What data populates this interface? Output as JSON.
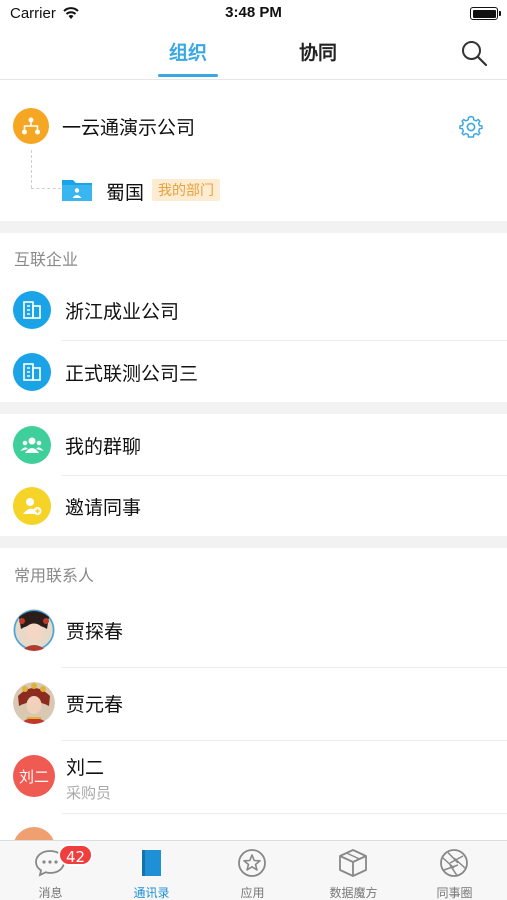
{
  "status_bar": {
    "carrier": "Carrier",
    "time": "3:48 PM"
  },
  "top_tabs": {
    "active": "组织",
    "inactive": "协同"
  },
  "organization": {
    "company_name": "一云通演示公司",
    "department": {
      "name": "蜀国",
      "badge": "我的部门"
    }
  },
  "partner_section": {
    "title": "互联企业",
    "items": [
      {
        "label": "浙江成业公司"
      },
      {
        "label": "正式联测公司三"
      }
    ]
  },
  "group_section": {
    "items": [
      {
        "label": "我的群聊",
        "icon": "group-chat-icon",
        "color": "#3ecf9b"
      },
      {
        "label": "邀请同事",
        "icon": "invite-colleague-icon",
        "color": "#f5d327"
      }
    ]
  },
  "contacts_section": {
    "title": "常用联系人",
    "contacts": [
      {
        "name": "贾探春",
        "role": ""
      },
      {
        "name": "贾元春",
        "role": ""
      },
      {
        "name": "刘二",
        "role": "采购员",
        "avatar_text": "刘二"
      }
    ]
  },
  "bottom_nav": {
    "items": [
      {
        "label": "消息",
        "icon": "message-icon",
        "badge": "42"
      },
      {
        "label": "通讯录",
        "icon": "contacts-book-icon",
        "active": true
      },
      {
        "label": "应用",
        "icon": "star-icon"
      },
      {
        "label": "数据魔方",
        "icon": "cube-icon"
      },
      {
        "label": "同事圈",
        "icon": "camera-shutter-icon"
      }
    ]
  },
  "colors": {
    "accent": "#3aa7e3",
    "org_icon": "#f5a623",
    "partner_icon": "#1aa3e6",
    "badge_red": "#f03d3d"
  }
}
